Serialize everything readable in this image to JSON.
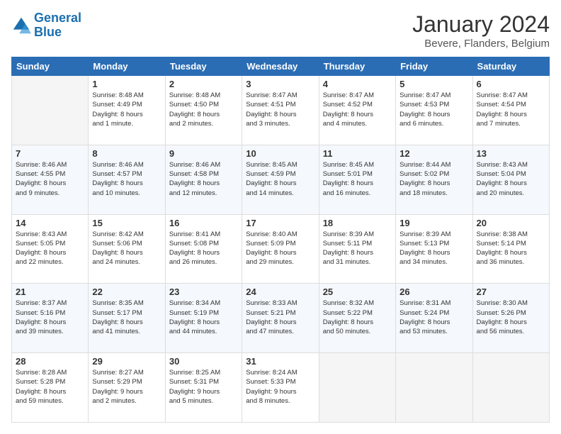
{
  "logo": {
    "line1": "General",
    "line2": "Blue"
  },
  "title": "January 2024",
  "subtitle": "Bevere, Flanders, Belgium",
  "days_header": [
    "Sunday",
    "Monday",
    "Tuesday",
    "Wednesday",
    "Thursday",
    "Friday",
    "Saturday"
  ],
  "weeks": [
    [
      {
        "day": "",
        "info": ""
      },
      {
        "day": "1",
        "info": "Sunrise: 8:48 AM\nSunset: 4:49 PM\nDaylight: 8 hours\nand 1 minute."
      },
      {
        "day": "2",
        "info": "Sunrise: 8:48 AM\nSunset: 4:50 PM\nDaylight: 8 hours\nand 2 minutes."
      },
      {
        "day": "3",
        "info": "Sunrise: 8:47 AM\nSunset: 4:51 PM\nDaylight: 8 hours\nand 3 minutes."
      },
      {
        "day": "4",
        "info": "Sunrise: 8:47 AM\nSunset: 4:52 PM\nDaylight: 8 hours\nand 4 minutes."
      },
      {
        "day": "5",
        "info": "Sunrise: 8:47 AM\nSunset: 4:53 PM\nDaylight: 8 hours\nand 6 minutes."
      },
      {
        "day": "6",
        "info": "Sunrise: 8:47 AM\nSunset: 4:54 PM\nDaylight: 8 hours\nand 7 minutes."
      }
    ],
    [
      {
        "day": "7",
        "info": "Sunrise: 8:46 AM\nSunset: 4:55 PM\nDaylight: 8 hours\nand 9 minutes."
      },
      {
        "day": "8",
        "info": "Sunrise: 8:46 AM\nSunset: 4:57 PM\nDaylight: 8 hours\nand 10 minutes."
      },
      {
        "day": "9",
        "info": "Sunrise: 8:46 AM\nSunset: 4:58 PM\nDaylight: 8 hours\nand 12 minutes."
      },
      {
        "day": "10",
        "info": "Sunrise: 8:45 AM\nSunset: 4:59 PM\nDaylight: 8 hours\nand 14 minutes."
      },
      {
        "day": "11",
        "info": "Sunrise: 8:45 AM\nSunset: 5:01 PM\nDaylight: 8 hours\nand 16 minutes."
      },
      {
        "day": "12",
        "info": "Sunrise: 8:44 AM\nSunset: 5:02 PM\nDaylight: 8 hours\nand 18 minutes."
      },
      {
        "day": "13",
        "info": "Sunrise: 8:43 AM\nSunset: 5:04 PM\nDaylight: 8 hours\nand 20 minutes."
      }
    ],
    [
      {
        "day": "14",
        "info": "Sunrise: 8:43 AM\nSunset: 5:05 PM\nDaylight: 8 hours\nand 22 minutes."
      },
      {
        "day": "15",
        "info": "Sunrise: 8:42 AM\nSunset: 5:06 PM\nDaylight: 8 hours\nand 24 minutes."
      },
      {
        "day": "16",
        "info": "Sunrise: 8:41 AM\nSunset: 5:08 PM\nDaylight: 8 hours\nand 26 minutes."
      },
      {
        "day": "17",
        "info": "Sunrise: 8:40 AM\nSunset: 5:09 PM\nDaylight: 8 hours\nand 29 minutes."
      },
      {
        "day": "18",
        "info": "Sunrise: 8:39 AM\nSunset: 5:11 PM\nDaylight: 8 hours\nand 31 minutes."
      },
      {
        "day": "19",
        "info": "Sunrise: 8:39 AM\nSunset: 5:13 PM\nDaylight: 8 hours\nand 34 minutes."
      },
      {
        "day": "20",
        "info": "Sunrise: 8:38 AM\nSunset: 5:14 PM\nDaylight: 8 hours\nand 36 minutes."
      }
    ],
    [
      {
        "day": "21",
        "info": "Sunrise: 8:37 AM\nSunset: 5:16 PM\nDaylight: 8 hours\nand 39 minutes."
      },
      {
        "day": "22",
        "info": "Sunrise: 8:35 AM\nSunset: 5:17 PM\nDaylight: 8 hours\nand 41 minutes."
      },
      {
        "day": "23",
        "info": "Sunrise: 8:34 AM\nSunset: 5:19 PM\nDaylight: 8 hours\nand 44 minutes."
      },
      {
        "day": "24",
        "info": "Sunrise: 8:33 AM\nSunset: 5:21 PM\nDaylight: 8 hours\nand 47 minutes."
      },
      {
        "day": "25",
        "info": "Sunrise: 8:32 AM\nSunset: 5:22 PM\nDaylight: 8 hours\nand 50 minutes."
      },
      {
        "day": "26",
        "info": "Sunrise: 8:31 AM\nSunset: 5:24 PM\nDaylight: 8 hours\nand 53 minutes."
      },
      {
        "day": "27",
        "info": "Sunrise: 8:30 AM\nSunset: 5:26 PM\nDaylight: 8 hours\nand 56 minutes."
      }
    ],
    [
      {
        "day": "28",
        "info": "Sunrise: 8:28 AM\nSunset: 5:28 PM\nDaylight: 8 hours\nand 59 minutes."
      },
      {
        "day": "29",
        "info": "Sunrise: 8:27 AM\nSunset: 5:29 PM\nDaylight: 9 hours\nand 2 minutes."
      },
      {
        "day": "30",
        "info": "Sunrise: 8:25 AM\nSunset: 5:31 PM\nDaylight: 9 hours\nand 5 minutes."
      },
      {
        "day": "31",
        "info": "Sunrise: 8:24 AM\nSunset: 5:33 PM\nDaylight: 9 hours\nand 8 minutes."
      },
      {
        "day": "",
        "info": ""
      },
      {
        "day": "",
        "info": ""
      },
      {
        "day": "",
        "info": ""
      }
    ]
  ]
}
